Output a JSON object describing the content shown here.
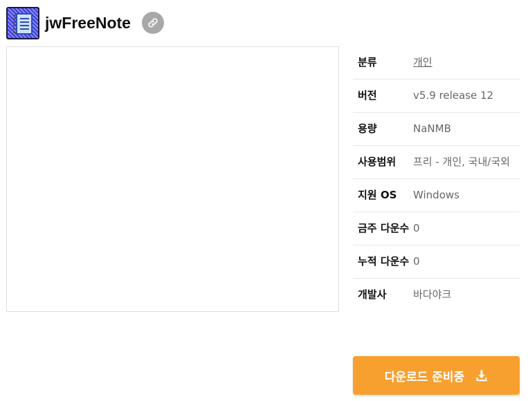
{
  "header": {
    "app_name": "jwFreeNote",
    "icon": "notebook-icon",
    "link_icon": "link-icon"
  },
  "info": {
    "rows": [
      {
        "label": "분류",
        "value": "개인",
        "is_link": true
      },
      {
        "label": "버전",
        "value": "v5.9 release 12"
      },
      {
        "label": "용량",
        "value": "NaNMB"
      },
      {
        "label": "사용범위",
        "value": "프리 - 개인, 국내/국외"
      },
      {
        "label": "지원 OS",
        "value": "Windows"
      },
      {
        "label": "금주 다운수",
        "value": "0"
      },
      {
        "label": "누적 다운수",
        "value": "0"
      },
      {
        "label": "개발사",
        "value": "바다야크"
      }
    ]
  },
  "download": {
    "label": "다운로드 준비중",
    "icon": "download-icon"
  },
  "colors": {
    "accent": "#f7a030",
    "link_button": "#a8a8a8"
  }
}
